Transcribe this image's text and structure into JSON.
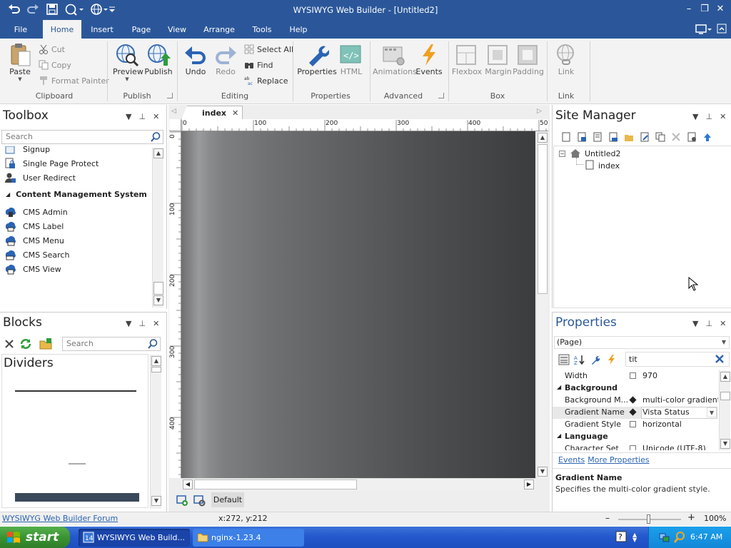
{
  "window": {
    "title": "WYSIWYG Web Builder - [Untitled2]",
    "minimize_label": "–",
    "restore_label": "❐",
    "close_label": "✕"
  },
  "menu": {
    "tabs": [
      "File",
      "Home",
      "Insert",
      "Page",
      "View",
      "Arrange",
      "Tools",
      "Help"
    ],
    "active": "Home"
  },
  "ribbon": {
    "clipboard": {
      "paste": "Paste",
      "cut": "Cut",
      "copy": "Copy",
      "format_painter": "Format Painter",
      "group": "Clipboard"
    },
    "publish": {
      "preview": "Preview",
      "publish": "Publish",
      "group": "Publish"
    },
    "editing": {
      "undo": "Undo",
      "redo": "Redo",
      "select_all": "Select All",
      "find": "Find",
      "replace": "Replace",
      "group": "Editing"
    },
    "properties": {
      "properties": "Properties",
      "html": "HTML",
      "group": "Properties"
    },
    "advanced": {
      "animations": "Animations",
      "events": "Events",
      "group": "Advanced"
    },
    "box": {
      "flexbox": "Flexbox",
      "margin": "Margin",
      "padding": "Padding",
      "group": "Box"
    },
    "link": {
      "link": "Link",
      "group": "Link"
    }
  },
  "toolbox": {
    "title": "Toolbox",
    "search_placeholder": "Search",
    "items_top": [
      "Signup",
      "Single Page Protect",
      "User Redirect"
    ],
    "category": "Content Management System",
    "cms_items": [
      "CMS Admin",
      "CMS Label",
      "CMS Menu",
      "CMS Search",
      "CMS View"
    ]
  },
  "blocks": {
    "title": "Blocks",
    "search_placeholder": "Search",
    "section": "Dividers"
  },
  "editor": {
    "tab": "index",
    "ruler_h": [
      "0",
      "100",
      "200",
      "300",
      "400",
      "50"
    ],
    "ruler_v": [
      "0",
      "100",
      "200",
      "300",
      "400"
    ],
    "layout_label": "Default"
  },
  "site_manager": {
    "title": "Site Manager",
    "root": "Untitled2",
    "pages": [
      "index"
    ]
  },
  "properties": {
    "title": "Properties",
    "selector": "(Page)",
    "filter_value": "tit",
    "rows": {
      "width_k": "Width",
      "width_v": "970",
      "cat_background": "Background",
      "bgmode_k": "Background M...",
      "bgmode_v": "multi-color gradient",
      "gradname_k": "Gradient Name",
      "gradname_v": "Vista Status",
      "gradstyle_k": "Gradient Style",
      "gradstyle_v": "horizontal",
      "cat_language": "Language",
      "charset_k": "Character Set",
      "charset_v": "Unicode (UTF-8)"
    },
    "links": [
      "Events",
      "More Properties"
    ],
    "desc_title": "Gradient Name",
    "desc_text": "Specifies the multi-color gradient style."
  },
  "status": {
    "forum_link": "WYSIWYG Web Builder Forum",
    "coords": "x:272, y:212",
    "zoom": "100%",
    "zoom_minus": "–",
    "zoom_plus": "+"
  },
  "taskbar": {
    "start": "start",
    "tasks": [
      "WYSIWYG Web Build...",
      "nginx-1.23.4"
    ],
    "clock": "6:47 AM"
  },
  "colors": {
    "brand": "#2b579a",
    "ribbon_bg": "#f3f3f3",
    "panel_title": "#2b579a",
    "taskbar": "#2458cc",
    "start_green": "#3a9433"
  }
}
